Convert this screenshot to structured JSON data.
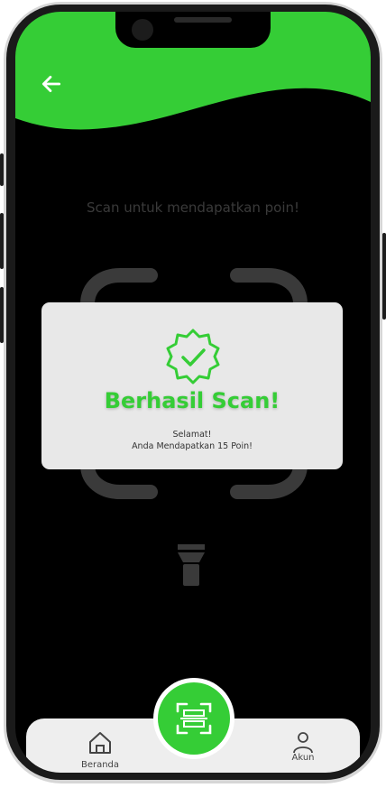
{
  "screen": {
    "instruction": "Scan untuk mendapatkan poin!"
  },
  "modal": {
    "title": "Berhasil Scan!",
    "message_line1": "Selamat!",
    "message_line2": "Anda Mendapatkan 15 Poin!"
  },
  "nav": {
    "home_label": "Beranda",
    "account_label": "Akun"
  },
  "icons": {
    "back": "arrow-left-icon",
    "badge": "verified-badge-icon",
    "flashlight": "flashlight-icon",
    "home": "home-icon",
    "scan": "qr-scan-icon",
    "account": "user-icon"
  },
  "colors": {
    "brand_green": "#35cd36",
    "background": "#000000",
    "nav_background": "#eeeeee",
    "modal_background": "#e8e8e8"
  }
}
